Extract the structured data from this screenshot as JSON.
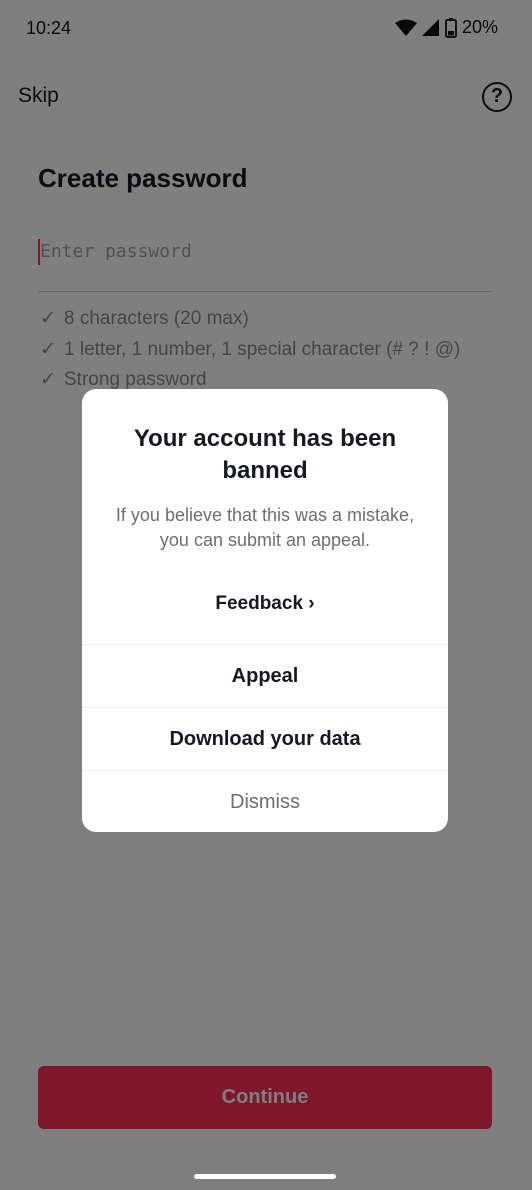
{
  "status_bar": {
    "time": "10:24",
    "battery": "20%",
    "icons": [
      "wifi-icon",
      "signal-icon",
      "battery-icon"
    ]
  },
  "top_bar": {
    "skip_label": "Skip",
    "help_icon": "help-icon"
  },
  "form": {
    "title": "Create password",
    "password_placeholder": "Enter password",
    "rules": [
      "8 characters (20 max)",
      "1 letter, 1 number, 1 special character (# ? ! @)",
      "Strong password"
    ],
    "check_glyph": "✓",
    "continue_label": "Continue"
  },
  "dialog": {
    "title": "Your account has been banned",
    "body": "If you believe that this was a mistake, you can submit an appeal.",
    "feedback_label": "Feedback",
    "feedback_arrow": "›",
    "actions": {
      "appeal": "Appeal",
      "download": "Download your data",
      "dismiss": "Dismiss"
    }
  },
  "colors": {
    "accent": "#fe2c55",
    "overlay": "rgba(0,0,0,0.5)"
  }
}
